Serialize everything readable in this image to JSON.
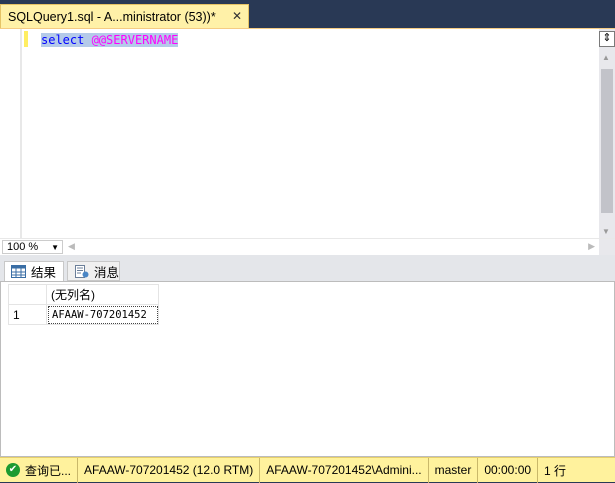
{
  "document_tab": {
    "title": "SQLQuery1.sql - A...ministrator (53))*",
    "close_glyph": "✕"
  },
  "editor": {
    "code_keyword": "select",
    "code_space": " ",
    "code_sysvar": "@@SERVERNAME",
    "split_glyph": "⇕"
  },
  "zoom": {
    "value": "100 %"
  },
  "result_tabs": [
    {
      "label": "结果",
      "icon": "grid-icon",
      "active": true
    },
    {
      "label": "消息",
      "icon": "message-icon",
      "active": false
    }
  ],
  "grid": {
    "columns": [
      "(无列名)"
    ],
    "rows": [
      {
        "row_number": "1",
        "values": [
          "AFAAW-707201452"
        ]
      }
    ]
  },
  "status_bar": {
    "status_icon": "check-icon",
    "status_text": "查询已...",
    "server": "AFAAW-707201452 (12.0 RTM)",
    "user": "AFAAW-707201452\\Admini...",
    "database": "master",
    "elapsed": "00:00:00",
    "rows": "1 行"
  },
  "colors": {
    "tab_active_bg": "#fff1a8",
    "status_bar_bg": "#fff29d",
    "chrome_bg": "#293955",
    "keyword": "#0000ff",
    "system_variable": "#ff00ff",
    "selection": "#b4cae9"
  }
}
